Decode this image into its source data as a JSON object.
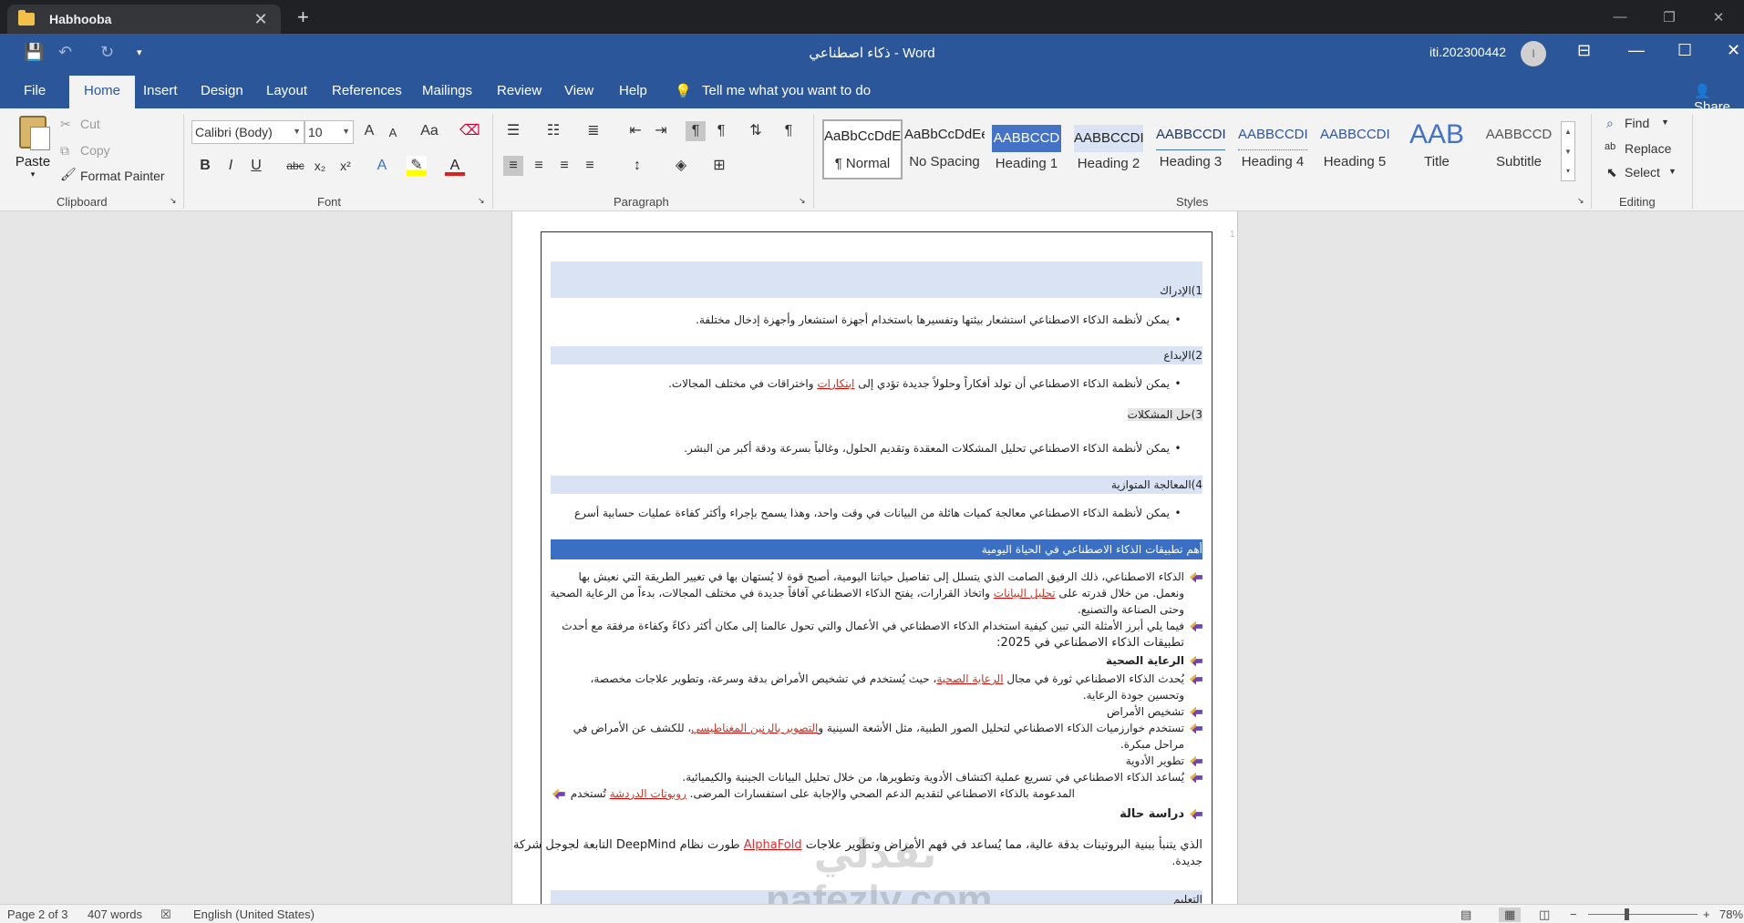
{
  "browser": {
    "tab_title": "Habhooba",
    "tab_close": "✕",
    "new_tab": "+",
    "controls": [
      "—",
      "❐",
      "✕"
    ]
  },
  "titlebar": {
    "doc_name": "ذكاء اصطناعي",
    "separator": "-",
    "app": "Word",
    "user": "iti.202300442",
    "avatar_initial": "I",
    "quick_access": [
      "💾",
      "↶",
      "↻",
      "▾"
    ],
    "window_controls": [
      "⊟",
      "—",
      "☐",
      "✕"
    ]
  },
  "menu": {
    "items": [
      "File",
      "Home",
      "Insert",
      "Design",
      "Layout",
      "References",
      "Mailings",
      "Review",
      "View",
      "Help"
    ],
    "tell_me": "Tell me what you want to do",
    "share": "Share"
  },
  "ribbon": {
    "clipboard": {
      "paste": "Paste",
      "cut": "Cut",
      "copy": "Copy",
      "format_painter": "Format Painter",
      "label": "Clipboard"
    },
    "font": {
      "name": "Calibri (Body)",
      "size": "10",
      "label": "Font",
      "bold": "B",
      "italic": "I",
      "underline": "U",
      "strike": "abc",
      "sub": "x₂",
      "sup": "x²",
      "grow": "A",
      "shrink": "A",
      "case": "Aa"
    },
    "paragraph": {
      "label": "Paragraph"
    },
    "styles": {
      "label": "Styles",
      "items": [
        {
          "preview": "AaBbCcDdEe",
          "name": "¶ Normal"
        },
        {
          "preview": "AaBbCcDdEe",
          "name": "No Spacing"
        },
        {
          "preview": "AABBCCD",
          "name": "Heading 1"
        },
        {
          "preview": "AABBCCDI",
          "name": "Heading 2"
        },
        {
          "preview": "AABBCCDI",
          "name": "Heading 3"
        },
        {
          "preview": "AABBCCDI",
          "name": "Heading 4"
        },
        {
          "preview": "AABBCCDI",
          "name": "Heading 5"
        },
        {
          "preview": "AAB",
          "name": "Title"
        },
        {
          "preview": "AABBCCD",
          "name": "Subtitle"
        }
      ]
    },
    "editing": {
      "label": "Editing",
      "find": "Find",
      "replace": "Replace",
      "select": "Select"
    }
  },
  "document": {
    "page_marker": "1",
    "h1": "1)الإدراك",
    "p1": "يمكن لأنظمة الذكاء الاصطناعي استشعار بيئتها وتفسيرها باستخدام أجهزة استشعار وأجهزة إدخال مختلفة.",
    "h2": "2)الإبداع",
    "p2a": "يمكن لأنظمة الذكاء الاصطناعي أن تولد أفكاراً وحلولاً جديدة تؤدي إلى",
    "p2b": "ابتكارات",
    "p2c": "واختراقات في مختلف المجالات.",
    "h3": "3)حل المشكلات",
    "p3": "يمكن لأنظمة الذكاء الاصطناعي تحليل المشكلات المعقدة وتقديم الحلول، وغالباً بسرعة ودقة أكبر من البشر.",
    "h4": "4)المعالجة المتوازية",
    "p4": "يمكن لأنظمة الذكاء الاصطناعي معالجة كميات هائلة من البيانات في وقت واحد، وهذا يسمح بإجراء وأكثر كفاءة عمليات حسابية أسرع",
    "h5": "أهم تطبيقات الذكاء الاصطناعي في الحياة اليومية",
    "l1": "الذكاء الاصطناعي، ذلك الرفيق الصامت الذي يتسلل إلى تفاصيل حياتنا اليومية، أصبح قوة لا يُستهان بها في تغيير الطريقة التي نعيش بها",
    "l2a": "ونعمل. من خلال قدرته على",
    "l2b": "تحليل البيانات",
    "l2c": "واتخاذ القرارات، يفتح الذكاء الاصطناعي آفاقاً جديدة في مختلف المجالات، بدءاً من الرعاية الصحية",
    "l3": "وحتى الصناعة والتصنيع.",
    "l4": "فيما يلي أبرز الأمثلة التي تبين كيفية استخدام الذكاء الاصطناعي في الأعمال والتي تحول عالمنا إلى مكان أكثر ذكاءً وكفاءة مرفقة مع أحدث",
    "l5": "تطبيقات الذكاء الاصطناعي في 2025:",
    "l6": "الرعاية الصحية",
    "l7a": "يُحدث الذكاء الاصطناعي ثورة في مجال",
    "l7b": "الرعاية الصحية",
    "l7c": "، حيث يُستخدم في تشخيص الأمراض بدقة وسرعة، وتطوير علاجات مخصصة،",
    "l8": "وتحسين جودة الرعاية.",
    "l9": "تشخيص الأمراض",
    "l10a": "تستخدم خوارزميات الذكاء الاصطناعي لتحليل الصور الطبية، مثل الأشعة السينية و",
    "l10b": "التصوير بالرنين المغناطيسي",
    "l10c": "، للكشف عن الأمراض في",
    "l11": "مراحل مبكرة.",
    "l12": "تطوير الأدوية",
    "l13": "يُساعد الذكاء الاصطناعي في تسريع عملية اكتشاف الأدوية وتطويرها، من خلال تحليل البيانات الجينية والكيميائية.",
    "l14a": "تُستخدم",
    "l14b": "روبوتات الدردشة",
    "l14c": "المدعومة بالذكاء الاصطناعي لتقديم الدعم الصحي والإجابة على استفسارات المرضى.",
    "l15": "دراسة حالة",
    "l16a": "طورت نظام DeepMind التابعة لجوجل",
    "l16b": "AlphaFold",
    "l16c": "الذي يتنبأ ببنية البروتينات بدقة عالية، مما يُساعد في فهم الأمراض وتطوير علاجات",
    "l16d": "شركة",
    "l17": "جديدة.",
    "h6": "التعليم"
  },
  "watermark": "نفذلي nafezly.com",
  "status": {
    "page": "Page 2 of 3",
    "words": "407 words",
    "language": "English (United States)",
    "zoom": "78%",
    "zoom_minus": "−",
    "zoom_plus": "+"
  }
}
